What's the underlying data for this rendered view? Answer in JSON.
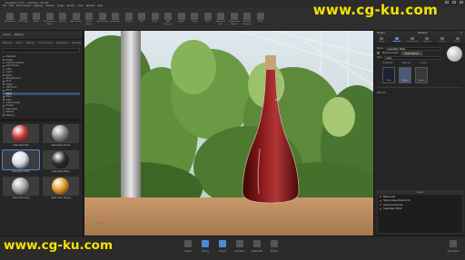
{
  "window": {
    "title": "KeyShot 9 Pro - Untitled - 64 bit",
    "menu": [
      "File",
      "Edit",
      "Environment",
      "Lighting",
      "Camera",
      "Image",
      "Render",
      "View",
      "Window",
      "Help"
    ]
  },
  "toolbar": {
    "buttons": [
      {
        "label": "Workspaces",
        "icon": "workspaces-icon"
      },
      {
        "label": "CPU Usage",
        "icon": "cpu-icon"
      },
      {
        "label": "Pause",
        "icon": "pause-icon"
      },
      {
        "label": "Performance Mode",
        "icon": "performance-icon"
      },
      {
        "label": "Denoise",
        "icon": "denoise-icon"
      },
      {
        "label": "Add Camera",
        "icon": "camera-icon"
      },
      {
        "label": "Reset Camera",
        "icon": "reset-icon"
      },
      {
        "label": "Lock Camera",
        "icon": "lock-icon"
      },
      {
        "label": "Perspective",
        "icon": "perspective-icon"
      },
      {
        "label": "Tumble",
        "icon": "tumble-icon"
      },
      {
        "label": "Pan",
        "icon": "pan-icon"
      },
      {
        "label": "Dolly",
        "icon": "dolly-icon"
      },
      {
        "label": "Add Geometry",
        "icon": "geometry-icon"
      },
      {
        "label": "Region",
        "icon": "region-icon"
      },
      {
        "label": "Studio",
        "icon": "studio-icon"
      },
      {
        "label": "Tools",
        "icon": "tools-icon"
      },
      {
        "label": "Geometry View",
        "icon": "geometry-view-icon"
      },
      {
        "label": "Configurator Wizard",
        "icon": "wizard-icon"
      },
      {
        "label": "Material Templates",
        "icon": "templates-icon"
      },
      {
        "label": "Script",
        "icon": "script-icon"
      }
    ]
  },
  "watermark": {
    "top": "www.cg-ku.com",
    "bottom": "www.cg-ku.com"
  },
  "library": {
    "title": "Library",
    "header_tabs": [
      "Library",
      "Material"
    ],
    "tabs": [
      "Materials",
      "Colors",
      "Textures",
      "Environments",
      "Backplates",
      "Favorites"
    ],
    "tree": [
      {
        "label": "Materials",
        "selected": false
      },
      {
        "label": "Axalta",
        "selected": false
      },
      {
        "label": "Cloth and Leather",
        "selected": false
      },
      {
        "label": "Gem Stones",
        "selected": false
      },
      {
        "label": "Light",
        "selected": false
      },
      {
        "label": "Liquid",
        "selected": false
      },
      {
        "label": "Metal",
        "selected": false
      },
      {
        "label": "Miscellaneous",
        "selected": false
      },
      {
        "label": "Paint",
        "selected": false
      },
      {
        "label": "Plastic",
        "selected": false
      },
      {
        "label": "Soft Touch",
        "selected": false
      },
      {
        "label": "Stone",
        "selected": false
      },
      {
        "label": "Glass",
        "selected": true
      },
      {
        "label": "Black",
        "selected": false
      },
      {
        "label": "Clear",
        "selected": false
      },
      {
        "label": "Colored Glass",
        "selected": false
      },
      {
        "label": "Frosted",
        "selected": false
      },
      {
        "label": "Glass Solid",
        "selected": false
      },
      {
        "label": "Stained",
        "selected": false
      },
      {
        "label": "Patterns",
        "selected": false
      }
    ],
    "materials": [
      {
        "label": "Glass Basic Red",
        "color": "#c23a3a",
        "selected": false
      },
      {
        "label": "Glass Basic Smoke",
        "color": "#888888",
        "selected": false
      },
      {
        "label": "Glass Basic White",
        "color": "#d9dde6",
        "selected": true
      },
      {
        "label": "Glass Basic Black",
        "color": "#2a2a2a",
        "selected": false
      },
      {
        "label": "Glass Clean Gray",
        "color": "#a7a7a7",
        "selected": false
      },
      {
        "label": "Glass Clean Orange",
        "color": "#e09a25",
        "selected": false
      }
    ]
  },
  "material_panel": {
    "header": "Project",
    "title": "Material",
    "tabs": [
      "Scene",
      "Material",
      "Environment",
      "Lighting",
      "Camera",
      "Image"
    ],
    "active_tab": "Material",
    "name_label": "Name",
    "name_value": "Glass Basic White",
    "checkbox_label": "Personal Graph",
    "button_label": "Multi-Material",
    "type_label": "Type",
    "type_value": "Glass",
    "subtabs": [
      "Properties",
      "Textures",
      "Labels"
    ],
    "active_subtab": "Textures",
    "swatches": [
      {
        "label": "Color",
        "color": "#1d2230"
      },
      {
        "label": "Bump",
        "color": "#4a5a78"
      },
      {
        "label": "Opacity",
        "color": "#3a3a3a"
      }
    ],
    "textures_label": "Textures",
    "scene_header": "Scene",
    "scene_items": [
      "Material #1",
      "Stained Glass Material #1",
      "Liquid Chardonnay",
      "Glass Basic White"
    ]
  },
  "bottom_bar": {
    "items": [
      {
        "label": "Import",
        "icon": "import-icon",
        "active": false
      },
      {
        "label": "Library",
        "icon": "library-icon",
        "active": true
      },
      {
        "label": "Project",
        "icon": "project-icon",
        "active": true
      },
      {
        "label": "Animation",
        "icon": "animation-icon",
        "active": false
      },
      {
        "label": "KeyShotVR",
        "icon": "keyshotvr-icon",
        "active": false
      },
      {
        "label": "Render",
        "icon": "render-icon",
        "active": false
      }
    ],
    "screenshot_label": "Screenshot"
  },
  "colors": {
    "accent": "#4a8ad8",
    "watermark": "#f5e400",
    "wine": "#7a1414",
    "cork": "#c7a37a",
    "table": "#b88a5c"
  }
}
